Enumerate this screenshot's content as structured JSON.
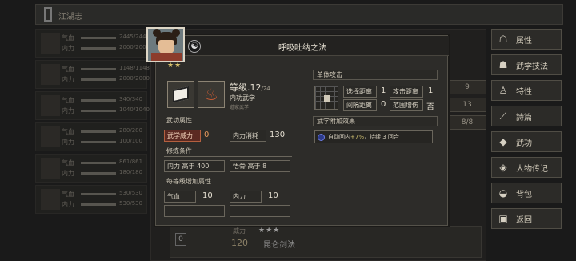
{
  "topbar": {
    "title": "江湖志"
  },
  "bg_list": [
    {
      "l1": "气血",
      "l2": "内力",
      "n1": "2445/2445",
      "n2": "2000/2000"
    },
    {
      "l1": "气血",
      "l2": "内力",
      "n1": "1148/1148",
      "n2": "2000/2000"
    },
    {
      "l1": "气血",
      "l2": "内力",
      "n1": "340/340",
      "n2": "1040/1040"
    },
    {
      "l1": "气血",
      "l2": "内力",
      "n1": "280/280",
      "n2": "100/100"
    },
    {
      "l1": "气血",
      "l2": "内力",
      "n1": "861/861",
      "n2": "180/180"
    },
    {
      "l1": "气血",
      "l2": "内力",
      "n1": "530/530",
      "n2": "530/530"
    }
  ],
  "bg_right_col": [
    "9",
    "13",
    "8/8"
  ],
  "side_menu": [
    {
      "label": "属性",
      "icon": "person-icon",
      "glyph": "☖"
    },
    {
      "label": "武学技法",
      "icon": "martial-icon",
      "glyph": "☗"
    },
    {
      "label": "特性",
      "icon": "trait-icon",
      "glyph": "♙"
    },
    {
      "label": "詩篇",
      "icon": "sword-icon",
      "glyph": "⟋"
    },
    {
      "label": "武功",
      "icon": "book-icon",
      "glyph": "◆"
    },
    {
      "label": "人物传记",
      "icon": "scroll-icon",
      "glyph": "◈"
    },
    {
      "label": "背包",
      "icon": "bag-icon",
      "glyph": "◒"
    },
    {
      "label": "返回",
      "icon": "return-icon",
      "glyph": "▣"
    }
  ],
  "bottom_strip": {
    "box": "0",
    "power_label": "威力",
    "power_value": "120",
    "stars": "★★★",
    "name": "昆仑剑法"
  },
  "skill": {
    "title": "呼吸吐纳之法",
    "stars": "★★",
    "level_label": "等级",
    "level": ".12",
    "level_max": "/24",
    "type": "内功武学",
    "subtype": "道家武学",
    "attr_header": "武功属性",
    "power_label": "武学威力",
    "power_value": "0",
    "mp_cost_label": "内力消耗",
    "mp_cost_value": "130",
    "req_header": "修炼条件",
    "req1": "内力 高于 400",
    "req2": "悟骨 高于 8",
    "bonus_header": "每等级增加属性",
    "bonus1_label": "气血",
    "bonus1_value": "10",
    "bonus2_label": "内力",
    "bonus2_value": "10",
    "target_header": "单体攻击",
    "select_range_label": "选择距离",
    "select_range_value": "1",
    "attack_range_label": "攻击距离",
    "attack_range_value": "1",
    "interval_label": "间隔距离",
    "interval_value": "0",
    "aoe_label": "范围增伤",
    "aoe_value": "否",
    "extra_header": "武学附加效果",
    "effect_pre": "自动回内",
    "effect_pct": "+7%",
    "effect_post": "，持续 3 回合"
  }
}
